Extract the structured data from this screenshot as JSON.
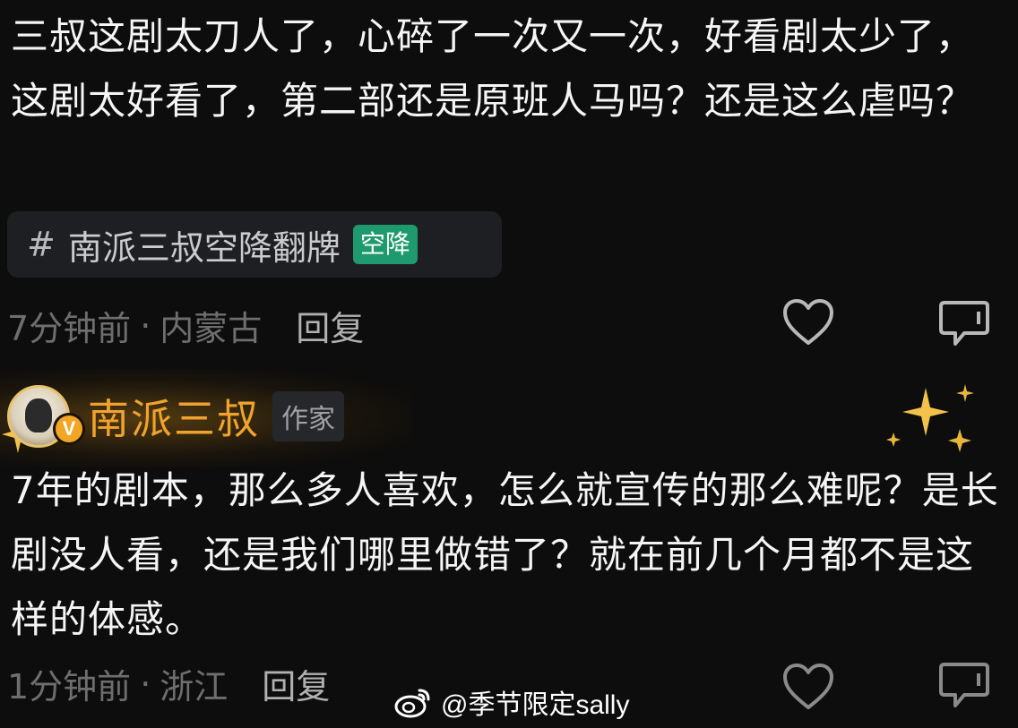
{
  "comments": [
    {
      "text": "三叔这剧太刀人了，心碎了一次又一次，好看剧太少了，这剧太好看了，第二部还是原班人马吗？还是这么虐吗？",
      "topic": {
        "label": "南派三叔空降翻牌",
        "badge": "空降"
      },
      "time": "7分钟前",
      "location": "内蒙古",
      "reply_label": "回复"
    },
    {
      "author": {
        "name": "南派三叔",
        "tag": "作家",
        "verified": "V"
      },
      "text": "7年的剧本，那么多人喜欢，怎么就宣传的那么难呢？是长剧没人看，还是我们哪里做错了？就在前几个月都不是这样的体感。",
      "time": "1分钟前",
      "location": "浙江",
      "reply_label": "回复"
    }
  ],
  "meta_separator": "·",
  "topic_hash": "#",
  "watermark": "@季节限定sally",
  "colors": {
    "background": "#0d0d0d",
    "author_name": "#f0a32c",
    "topic_badge": "#1f9a6e"
  },
  "icons": [
    "like-heart-icon",
    "comment-bubble-icon",
    "weibo-logo-icon",
    "sparkle-icon"
  ]
}
